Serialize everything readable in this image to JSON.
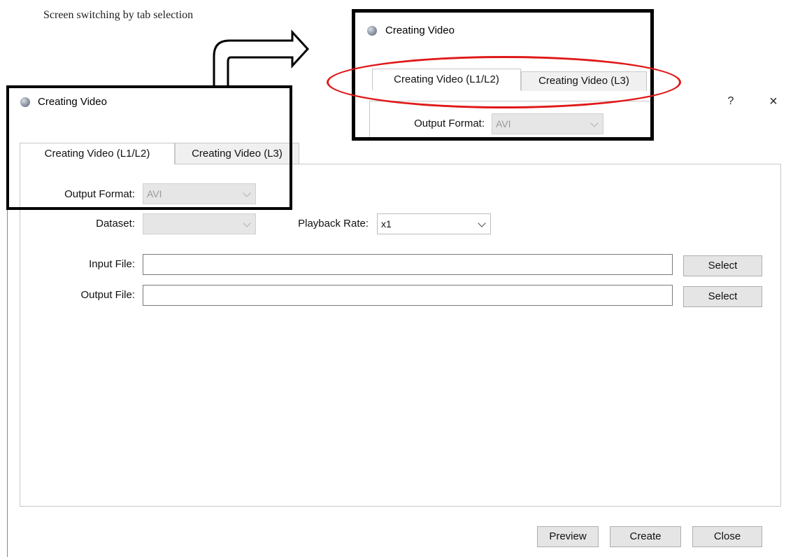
{
  "caption": "Screen switching by tab selection",
  "dialog": {
    "title": "Creating Video",
    "help_label": "?",
    "close_label": "×",
    "tabs": [
      {
        "label": "Creating Video (L1/L2)"
      },
      {
        "label": "Creating Video (L3)"
      }
    ],
    "output_format": {
      "label": "Output Format:",
      "value": "AVI"
    },
    "dataset": {
      "label": "Dataset:",
      "value": ""
    },
    "playback_rate": {
      "label": "Playback Rate:",
      "value": "x1"
    },
    "input_file": {
      "label": "Input File:",
      "value": "",
      "select_label": "Select"
    },
    "output_file": {
      "label": "Output File:",
      "value": "",
      "select_label": "Select"
    },
    "buttons": {
      "preview": "Preview",
      "create": "Create",
      "close": "Close"
    }
  },
  "zoom": {
    "title": "Creating Video",
    "tabs": [
      {
        "label": "Creating Video (L1/L2)"
      },
      {
        "label": "Creating Video (L3)"
      }
    ],
    "output_format": {
      "label": "Output Format:",
      "value": "AVI"
    }
  },
  "colors": {
    "highlight_ellipse": "#e01818",
    "frame": "#000000"
  },
  "icons": {
    "app": "app-globe-icon",
    "arrow": "bent-arrow-icon"
  }
}
